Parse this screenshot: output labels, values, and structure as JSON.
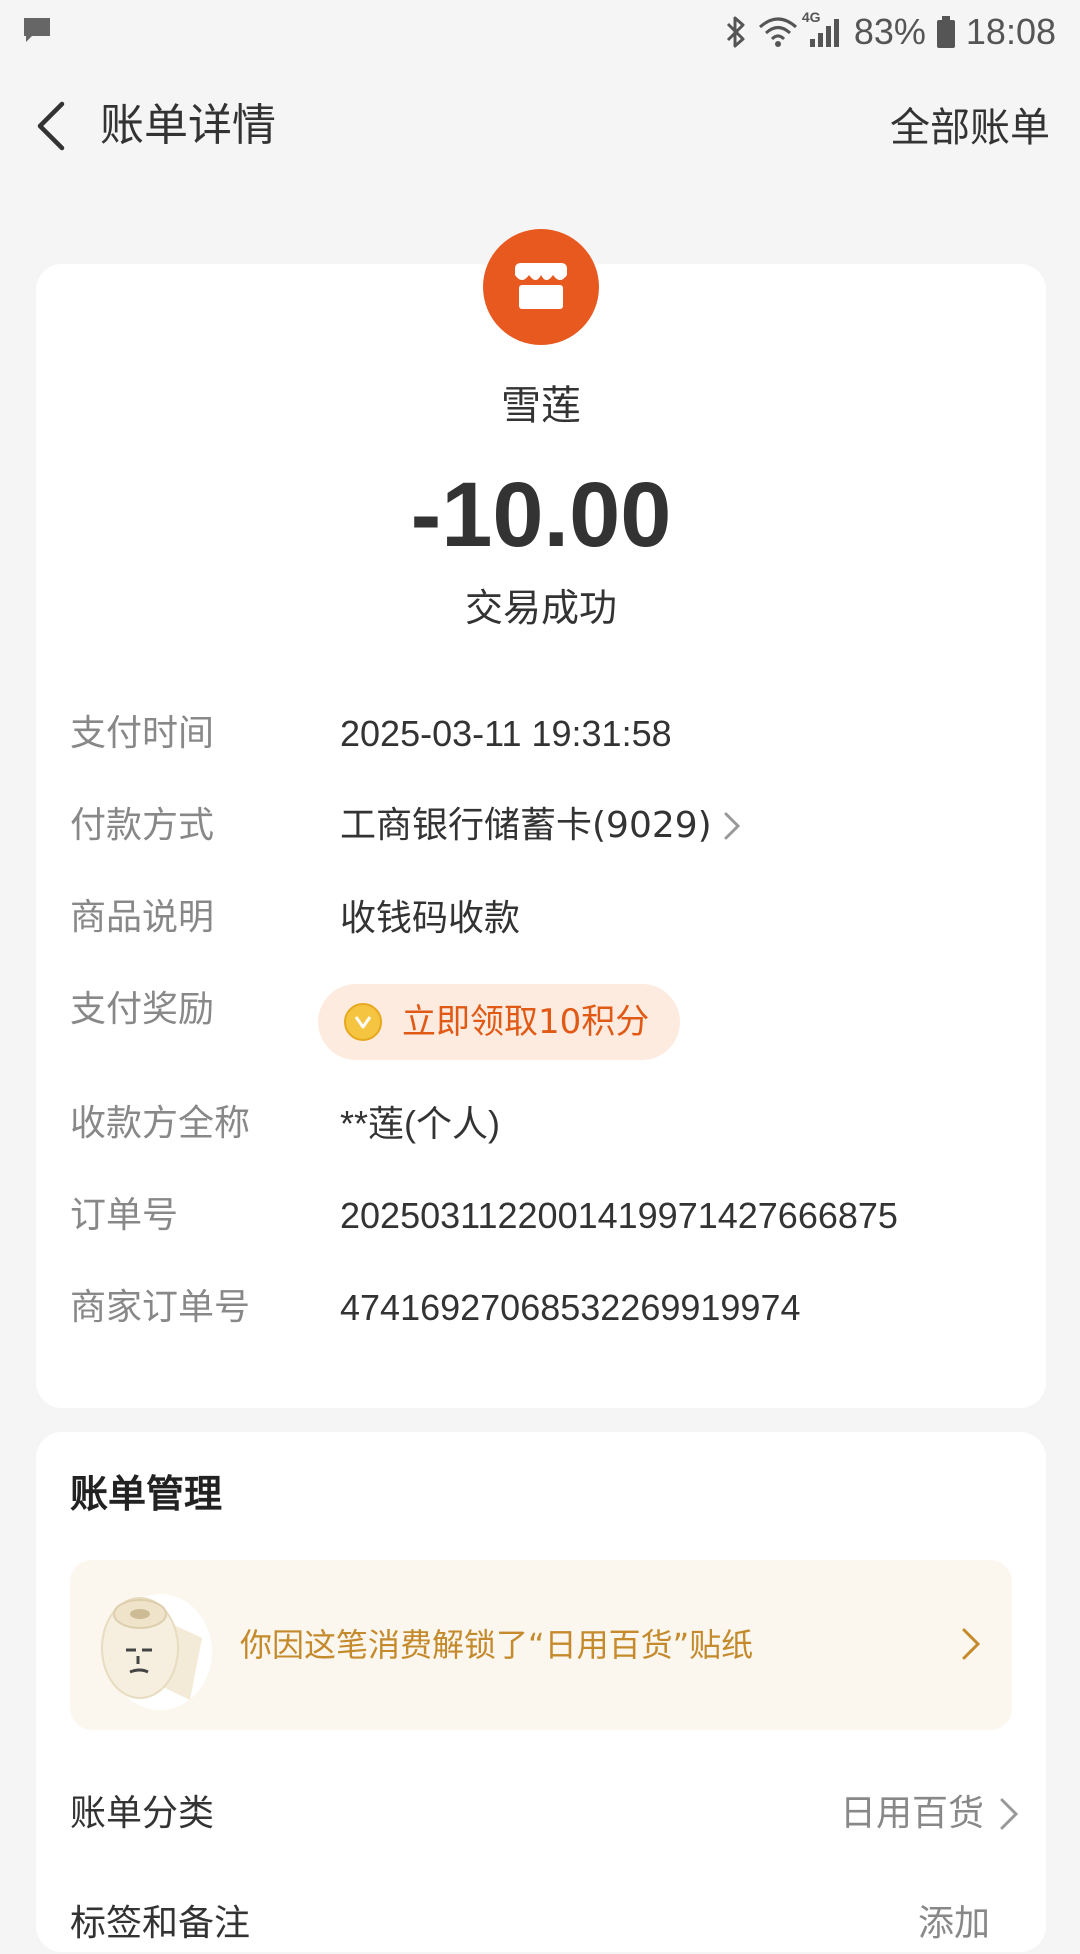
{
  "status_bar": {
    "battery": "83%",
    "time": "18:08",
    "network": "4G",
    "icons": [
      "message-icon",
      "bluetooth-icon",
      "wifi-icon",
      "signal-icon",
      "battery-icon"
    ]
  },
  "header": {
    "title": "账单详情",
    "all_bills": "全部账单"
  },
  "transaction": {
    "merchant": "雪莲",
    "amount": "-10.00",
    "status": "交易成功",
    "rows": [
      {
        "label": "支付时间",
        "value": "2025-03-11 19:31:58"
      },
      {
        "label": "付款方式",
        "value": "工商银行储蓄卡(9029)"
      },
      {
        "label": "商品说明",
        "value": "收钱码收款"
      },
      {
        "label": "支付奖励",
        "value": ""
      },
      {
        "label": "收款方全称",
        "value": "**莲(个人)"
      },
      {
        "label": "订单号",
        "value": "2025031122001419971427666875"
      },
      {
        "label": "商家订单号",
        "value": "474169270685322699199​74"
      }
    ],
    "reward_text": "立即领取10积分"
  },
  "management": {
    "title": "账单管理",
    "sticker_text": "你因这笔消费解锁了“日用百货”贴纸",
    "category_label": "账单分类",
    "category_value": "日用百货",
    "tags_label": "标签和备注",
    "tags_value": "添加"
  },
  "colors": {
    "background": "#f5f5f5",
    "card": "#ffffff",
    "accent_orange": "#e8591f",
    "reward_bg": "#fdebe0",
    "reward_text": "#e05a16",
    "sticker_bg": "#fbf6ee",
    "sticker_text": "#c48a2c"
  }
}
